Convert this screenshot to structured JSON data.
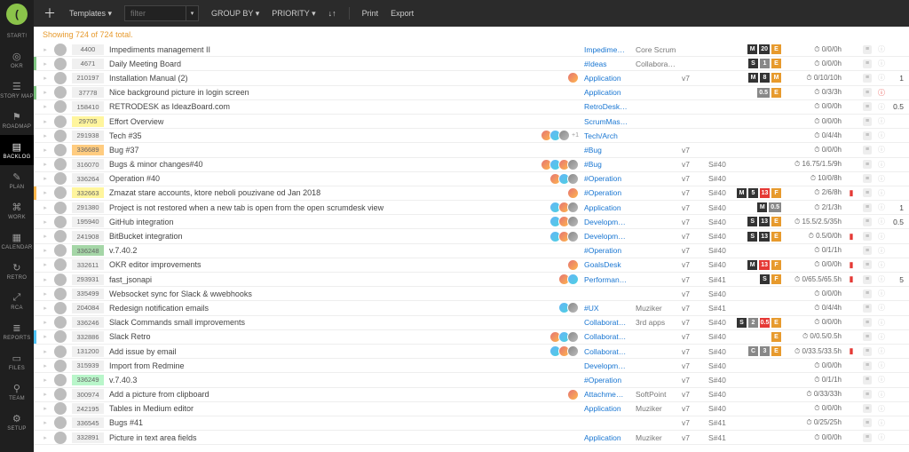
{
  "rail": {
    "start": "START!",
    "items": [
      {
        "icon": "◎",
        "label": "OKR"
      },
      {
        "icon": "☰",
        "label": "STORY MAP"
      },
      {
        "icon": "⚑",
        "label": "ROADMAP"
      },
      {
        "icon": "▤",
        "label": "BACKLOG",
        "active": true
      },
      {
        "icon": "✎",
        "label": "PLAN"
      },
      {
        "icon": "⌘",
        "label": "WORK"
      },
      {
        "icon": "▦",
        "label": "CALENDAR"
      },
      {
        "icon": "↻",
        "label": "RETRO"
      },
      {
        "icon": "⤢",
        "label": "RCA"
      },
      {
        "icon": "≣",
        "label": "REPORTS"
      },
      {
        "icon": "▭",
        "label": "FILES"
      },
      {
        "icon": "⚲",
        "label": "TEAM"
      },
      {
        "icon": "⚙",
        "label": "SETUP"
      }
    ]
  },
  "topbar": {
    "templates": "Templates ▾",
    "filter_ph": "filter",
    "groupby": "GROUP BY ▾",
    "priority": "PRIORITY ▾",
    "sort_icon": "↓↑",
    "print": "Print",
    "export": "Export"
  },
  "count": "Showing 724 of 724 total.",
  "rows": [
    {
      "id": "4400",
      "edge": "",
      "title": "Impediments management II",
      "av": [],
      "k": "Impedime…",
      "e": "Core Scrum",
      "c": "",
      "d": "",
      "badges": [
        [
          "dk",
          "M"
        ],
        [
          "dk",
          "20"
        ],
        [
          "or",
          "E"
        ]
      ],
      "time": "0/0/0h"
    },
    {
      "id": "4671",
      "edge": "green",
      "title": "Daily Meeting Board",
      "av": [],
      "k": "#Ideas",
      "e": "Collaborat…",
      "c": "",
      "d": "",
      "badges": [
        [
          "dk",
          "S"
        ],
        [
          "gr",
          "1"
        ],
        [
          "or",
          "E"
        ]
      ],
      "time": "0/0/0h"
    },
    {
      "id": "210197",
      "edge": "",
      "title": "Installation Manual (2)",
      "av": [
        "a"
      ],
      "k": "Application",
      "e": "",
      "c": "v7",
      "d": "",
      "badges": [
        [
          "dk",
          "M"
        ],
        [
          "dk",
          "8"
        ],
        [
          "or",
          "M"
        ]
      ],
      "time": "0/10/10h",
      "num": "1"
    },
    {
      "id": "37778",
      "edge": "green",
      "title": "Nice background picture in login screen",
      "av": [],
      "k": "Application",
      "e": "",
      "c": "",
      "d": "",
      "badges": [
        [
          "gr",
          "0.5"
        ],
        [
          "or",
          "E"
        ]
      ],
      "time": "0/3/3h",
      "inf": "ⓘ",
      "infc": "red"
    },
    {
      "id": "158410",
      "edge": "",
      "title": "RETRODESK as IdeazBoard.com",
      "av": [],
      "k": "RetroDesk…",
      "e": "",
      "c": "",
      "d": "",
      "badges": [],
      "time": "0/0/0h",
      "num": "0.5"
    },
    {
      "id": "29705",
      "edge": "",
      "idc": "c-yellow",
      "title": "Effort Overview",
      "av": [],
      "k": "ScrumMas…",
      "e": "",
      "c": "",
      "d": "",
      "badges": [],
      "time": "0/0/0h"
    },
    {
      "id": "291938",
      "edge": "",
      "title": "Tech #35",
      "av": [
        "a",
        "b",
        "g"
      ],
      "plus1": "+1",
      "k": "Tech/Arch",
      "e": "",
      "c": "",
      "d": "",
      "badges": [],
      "time": "0/4/4h"
    },
    {
      "id": "336689",
      "edge": "",
      "idc": "c-orange",
      "title": "Bug #37",
      "av": [],
      "k": "#Bug",
      "e": "",
      "c": "v7",
      "d": "",
      "badges": [],
      "time": "0/0/0h"
    },
    {
      "id": "316070",
      "edge": "",
      "title": "Bugs & minor changes#40",
      "av": [
        "a",
        "b",
        "a",
        "g"
      ],
      "k": "#Bug",
      "e": "",
      "c": "v7",
      "d": "S#40",
      "badges": [],
      "time": "16.75/1.5/9h"
    },
    {
      "id": "336264",
      "edge": "",
      "title": "Operation #40",
      "av": [
        "a",
        "b",
        "g"
      ],
      "k": "#Operation",
      "e": "",
      "c": "v7",
      "d": "S#40",
      "badges": [],
      "time": "10/0/8h"
    },
    {
      "id": "332663",
      "edge": "orange",
      "idc": "c-yellow",
      "title": "Zmazat stare accounts, ktore neboli pouzivane od Jan 2018",
      "av": [
        "a"
      ],
      "k": "#Operation",
      "e": "",
      "c": "v7",
      "d": "S#40",
      "badges": [
        [
          "dk",
          "M"
        ],
        [
          "dk",
          "5"
        ],
        [
          "rd",
          "13"
        ],
        [
          "or",
          "F"
        ]
      ],
      "time": "2/6/8h",
      "flag": "▮"
    },
    {
      "id": "291380",
      "edge": "",
      "title": "Project is not restored when a new tab is open from the open scrumdesk view",
      "av": [
        "b",
        "a",
        "g"
      ],
      "k": "Application",
      "e": "",
      "c": "v7",
      "d": "S#40",
      "badges": [
        [
          "dk",
          "M"
        ],
        [
          "gr",
          "0.5"
        ]
      ],
      "time": "2/1/3h",
      "num": "1"
    },
    {
      "id": "195940",
      "edge": "",
      "title": "GitHub integration",
      "av": [
        "b",
        "a",
        "g"
      ],
      "k": "Developm…",
      "e": "",
      "c": "v7",
      "d": "S#40",
      "badges": [
        [
          "dk",
          "S"
        ],
        [
          "dk",
          "13"
        ],
        [
          "or",
          "E"
        ]
      ],
      "time": "15.5/2.5/35h",
      "num": "0.5"
    },
    {
      "id": "241908",
      "edge": "",
      "title": "BitBucket integration",
      "av": [
        "b",
        "a",
        "g"
      ],
      "k": "Developm…",
      "e": "",
      "c": "v7",
      "d": "S#40",
      "badges": [
        [
          "dk",
          "S"
        ],
        [
          "dk",
          "13"
        ],
        [
          "or",
          "E"
        ]
      ],
      "time": "0.5/0/0h",
      "flag": "▮"
    },
    {
      "id": "336248",
      "edge": "",
      "idc": "c-green",
      "title": "v.7.40.2",
      "av": [],
      "k": "#Operation",
      "e": "",
      "c": "v7",
      "d": "S#40",
      "badges": [],
      "time": "0/1/1h"
    },
    {
      "id": "332611",
      "edge": "",
      "title": "OKR editor improvements",
      "av": [
        "a"
      ],
      "k": "GoalsDesk",
      "e": "",
      "c": "v7",
      "d": "S#40",
      "badges": [
        [
          "dk",
          "M"
        ],
        [
          "rd",
          "13"
        ],
        [
          "or",
          "F"
        ]
      ],
      "time": "0/0/0h",
      "flag": "▮"
    },
    {
      "id": "293931",
      "edge": "",
      "title": "fast_jsonapi",
      "av": [
        "a",
        "b"
      ],
      "k": "Performan…",
      "e": "",
      "c": "v7",
      "d": "S#41",
      "badges": [
        [
          "dk",
          "S"
        ],
        [
          "or",
          "F"
        ]
      ],
      "time": "0/65.5/65.5h",
      "flag": "▮",
      "num": "5"
    },
    {
      "id": "335499",
      "edge": "",
      "title": "Websocket sync for Slack & wwebhooks",
      "av": [],
      "k": "",
      "e": "",
      "c": "v7",
      "d": "S#40",
      "badges": [],
      "time": "0/0/0h"
    },
    {
      "id": "204084",
      "edge": "",
      "title": "Redesign notification emails",
      "av": [
        "b",
        "g"
      ],
      "k": "#UX",
      "e": "Muziker",
      "c": "v7",
      "d": "S#41",
      "badges": [],
      "time": "0/4/4h"
    },
    {
      "id": "336246",
      "edge": "",
      "title": "Slack Commands small improvements",
      "av": [],
      "k": "Collaborat…",
      "e": "3rd apps",
      "c": "v7",
      "d": "S#40",
      "badges": [
        [
          "dk",
          "S"
        ],
        [
          "gr",
          "2"
        ],
        [
          "rd",
          "0.5"
        ],
        [
          "or",
          "E"
        ]
      ],
      "time": "0/0/0h"
    },
    {
      "id": "332886",
      "edge": "lblue",
      "title": "Slack Retro",
      "av": [
        "a",
        "b",
        "g"
      ],
      "k": "Collaborat…",
      "e": "",
      "c": "v7",
      "d": "S#40",
      "badges": [
        [
          "or",
          "E"
        ]
      ],
      "time": "0/0.5/0.5h"
    },
    {
      "id": "131200",
      "edge": "",
      "title": "Add issue by email",
      "av": [
        "b",
        "a",
        "g"
      ],
      "k": "Collaborat…",
      "e": "",
      "c": "v7",
      "d": "S#40",
      "badges": [
        [
          "gr",
          "C"
        ],
        [
          "gr",
          "3"
        ],
        [
          "or",
          "E"
        ]
      ],
      "time": "0/33.5/33.5h",
      "flag": "▮"
    },
    {
      "id": "315939",
      "edge": "",
      "title": "Import from Redmine",
      "av": [],
      "k": "Developm…",
      "e": "",
      "c": "v7",
      "d": "S#40",
      "badges": [],
      "time": "0/0/0h"
    },
    {
      "id": "336249",
      "edge": "",
      "idc": "c-lgreen",
      "title": "v.7.40.3",
      "av": [],
      "k": "#Operation",
      "e": "",
      "c": "v7",
      "d": "S#40",
      "badges": [],
      "time": "0/1/1h"
    },
    {
      "id": "300974",
      "edge": "",
      "title": "Add a picture from clipboard",
      "av": [
        "a"
      ],
      "k": "Attachme…",
      "e": "SoftPoint",
      "c": "v7",
      "d": "S#40",
      "badges": [],
      "time": "0/33/33h"
    },
    {
      "id": "242195",
      "edge": "",
      "title": "Tables in Medium editor",
      "av": [],
      "k": "Application",
      "e": "Muziker",
      "c": "v7",
      "d": "S#40",
      "badges": [],
      "time": "0/0/0h"
    },
    {
      "id": "336545",
      "edge": "",
      "title": "Bugs #41",
      "av": [],
      "k": "",
      "e": "",
      "c": "v7",
      "d": "S#41",
      "badges": [],
      "time": "0/25/25h"
    },
    {
      "id": "332891",
      "edge": "",
      "title": "Picture in text area fields",
      "av": [],
      "k": "Application",
      "e": "Muziker",
      "c": "v7",
      "d": "S#41",
      "badges": [],
      "time": "0/0/0h"
    }
  ]
}
